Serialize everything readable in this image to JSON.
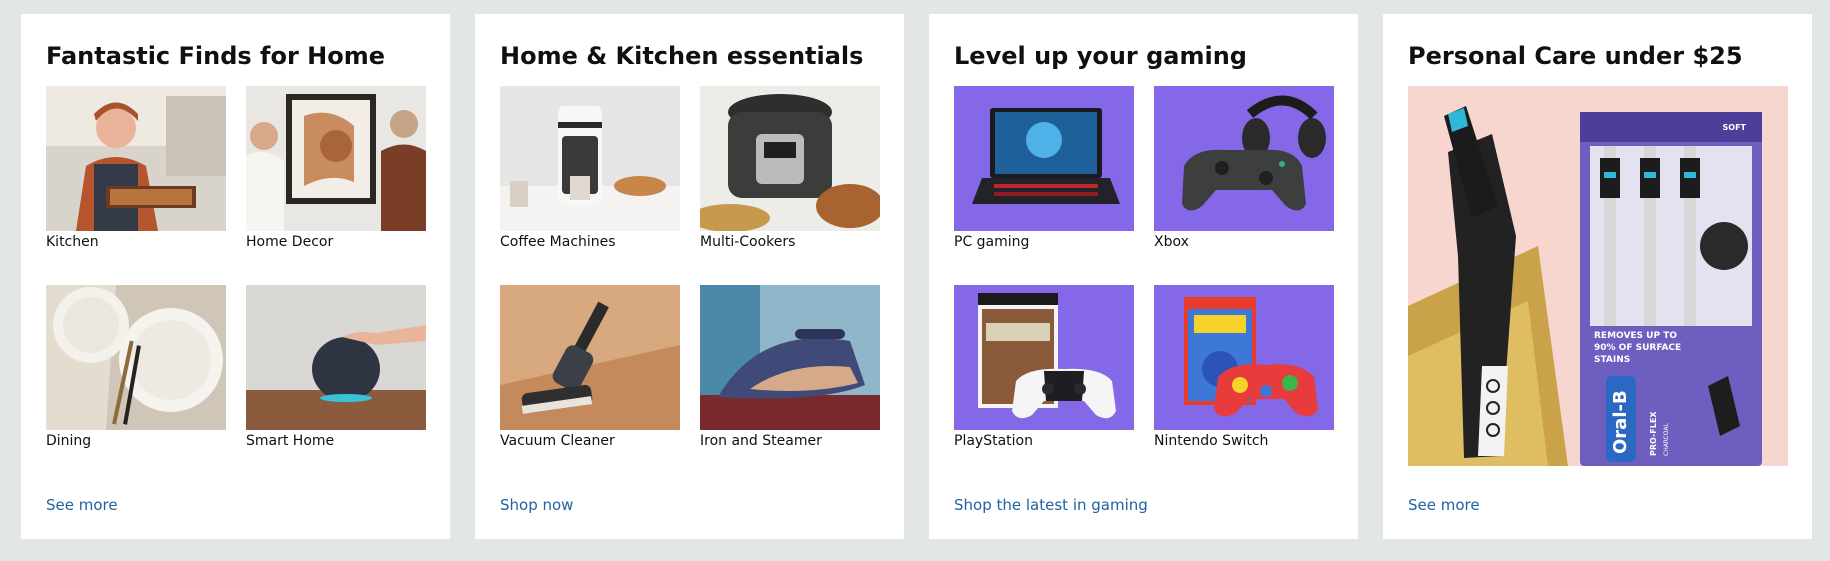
{
  "cards": [
    {
      "title": "Fantastic Finds for Home",
      "tiles": [
        {
          "label": "Kitchen",
          "icon": "kitchen-image"
        },
        {
          "label": "Home Decor",
          "icon": "home-decor-image"
        },
        {
          "label": "Dining",
          "icon": "dining-image"
        },
        {
          "label": "Smart Home",
          "icon": "smart-home-image"
        }
      ],
      "link": "See more"
    },
    {
      "title": "Home & Kitchen essentials",
      "tiles": [
        {
          "label": "Coffee Machines",
          "icon": "coffee-machine-image"
        },
        {
          "label": "Multi-Cookers",
          "icon": "multi-cooker-image"
        },
        {
          "label": "Vacuum Cleaner",
          "icon": "vacuum-cleaner-image"
        },
        {
          "label": "Iron and Steamer",
          "icon": "iron-steamer-image"
        }
      ],
      "link": "Shop now"
    },
    {
      "title": "Level up your gaming",
      "tiles": [
        {
          "label": "PC gaming",
          "icon": "gaming-laptop-image"
        },
        {
          "label": "Xbox",
          "icon": "xbox-controller-headset-image"
        },
        {
          "label": "PlayStation",
          "icon": "playstation-controller-game-image"
        },
        {
          "label": "Nintendo Switch",
          "icon": "nintendo-controller-game-image"
        }
      ],
      "link": "Shop the latest in gaming"
    },
    {
      "title": "Personal Care under $25",
      "hero": {
        "icon": "toothbrush-pack-image",
        "pack_text_soft": "SOFT",
        "pack_text_removes": "REMOVES UP TO",
        "pack_text_percent": "90% OF SURFACE",
        "pack_text_stains": "STAINS",
        "pack_brand": "Oral-B",
        "pack_line": "PRO-FLEX",
        "pack_sub": "CHARCOAL"
      },
      "link": "See more"
    }
  ],
  "colors": {
    "page_bg": "#e3e6e6",
    "card_bg": "#ffffff",
    "title": "#0f1111",
    "link": "#2162a1",
    "gaming_bg": "#8468e8",
    "care_bg": "#f7d6d0"
  }
}
